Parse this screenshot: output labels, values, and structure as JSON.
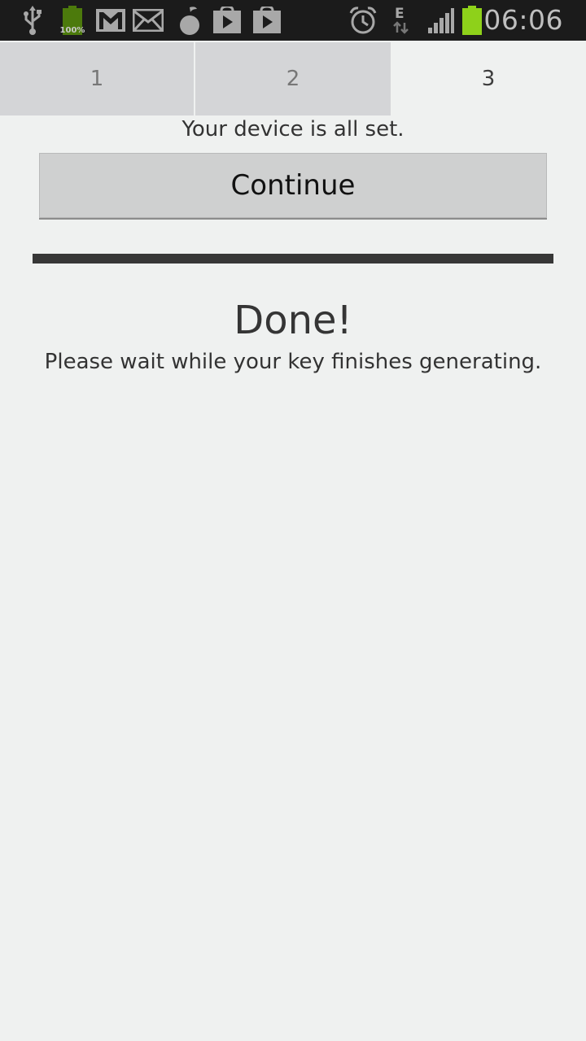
{
  "status_bar": {
    "time": "06:06",
    "battery_level_text": "100%",
    "network_type": "E",
    "icons": [
      "usb-icon",
      "battery-full-icon",
      "gmail-icon",
      "email-icon",
      "orfox-icon",
      "play-store-icon",
      "play-store-icon",
      "alarm-icon",
      "data-transfer-icon",
      "signal-icon",
      "battery-icon"
    ],
    "battery_color": "#8ed11a"
  },
  "steps": {
    "items": [
      {
        "label": "1",
        "active": false
      },
      {
        "label": "2",
        "active": false
      },
      {
        "label": "3",
        "active": true
      }
    ]
  },
  "main": {
    "status_text": "Your device is all set.",
    "continue_label": "Continue",
    "done_title": "Done!",
    "done_message": "Please wait while your key finishes generating."
  }
}
